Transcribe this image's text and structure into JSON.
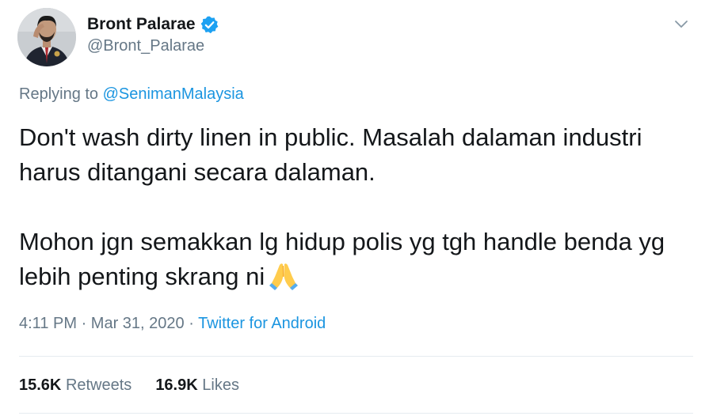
{
  "author": {
    "display_name": "Bront Palarae",
    "handle": "@Bront_Palarae",
    "verified": true,
    "verified_icon": "verified-badge-icon",
    "verified_color": "#1da1f2"
  },
  "reply": {
    "prefix": "Replying to",
    "mention": "@SenimanMalaysia"
  },
  "tweet": {
    "paragraph_1": "Don't wash dirty linen in public. Masalah dalaman industri harus ditangani secara dalaman.",
    "paragraph_2": "Mohon jgn semakkan lg hidup polis yg tgh handle benda yg lebih penting skrang ni",
    "emoji": "folded-hands-icon"
  },
  "meta": {
    "time": "4:11 PM",
    "separator": "·",
    "date": "Mar 31, 2020",
    "source": "Twitter for Android"
  },
  "stats": {
    "retweets_count": "15.6K",
    "retweets_label": "Retweets",
    "likes_count": "16.9K",
    "likes_label": "Likes"
  },
  "colors": {
    "text": "#14171a",
    "secondary": "#657786",
    "link": "#1b95e0",
    "divider": "#e6ecf0"
  }
}
